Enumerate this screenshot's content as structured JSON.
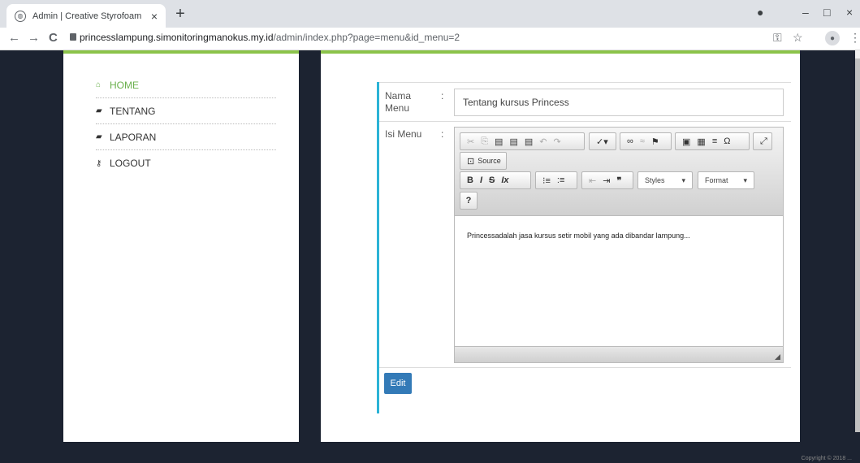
{
  "browser": {
    "tab_title": "Admin | Creative Styrofoam",
    "tab_close": "×",
    "new_tab": "+",
    "url_host": "princesslampung.simonitoringmanokus.my.id",
    "url_path": "/admin/index.php?page=menu&id_menu=2",
    "back": "←",
    "forward": "→",
    "reload": "C",
    "minimize": "–",
    "maximize": "□",
    "close": "×",
    "key_icon": "⚿",
    "star": "☆",
    "more": "⋮"
  },
  "sidebar": {
    "items": [
      {
        "icon": "home-icon",
        "glyph": "⌂",
        "label": "HOME"
      },
      {
        "icon": "book-icon",
        "glyph": "▰",
        "label": "TENTANG"
      },
      {
        "icon": "book-icon",
        "glyph": "▰",
        "label": "LAPORAN"
      },
      {
        "icon": "key-icon",
        "glyph": "⚷",
        "label": "LOGOUT"
      }
    ]
  },
  "form": {
    "name_label": "Nama Menu",
    "name_value": "Tentang kursus Princess",
    "content_label": "Isi Menu",
    "colon": ":",
    "content_value": "Princessadalah jasa kursus setir mobil yang ada dibandar lampung...",
    "submit_label": "Edit"
  },
  "editor": {
    "source_label": "Source",
    "styles_label": "Styles",
    "format_label": "Format",
    "help_label": "?"
  },
  "footer": {
    "text": "Copyright © 2018 ..."
  }
}
